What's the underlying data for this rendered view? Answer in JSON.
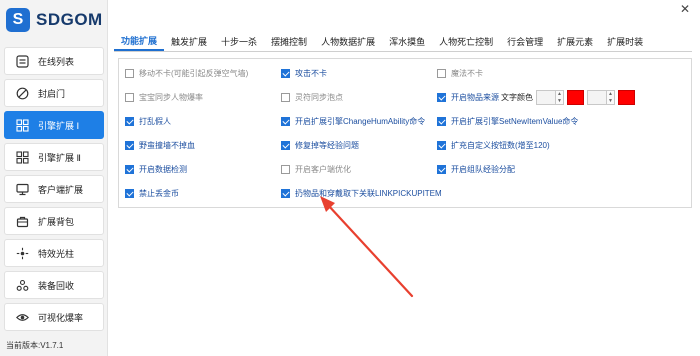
{
  "app": {
    "logo_text": "SDGOM",
    "version": "当前版本:V1.7.1"
  },
  "sidebar": {
    "items": [
      {
        "label": "在线列表",
        "icon": "list-icon",
        "active": false
      },
      {
        "label": "封启门",
        "icon": "ban-icon",
        "active": false
      },
      {
        "label": "引擎扩展 Ⅰ",
        "icon": "grid-icon",
        "active": true
      },
      {
        "label": "引擎扩展 Ⅱ",
        "icon": "grid-icon",
        "active": false
      },
      {
        "label": "客户端扩展",
        "icon": "monitor-icon",
        "active": false
      },
      {
        "label": "扩展背包",
        "icon": "bag-icon",
        "active": false
      },
      {
        "label": "特效光柱",
        "icon": "sparkle-icon",
        "active": false
      },
      {
        "label": "装备回收",
        "icon": "recycle-icon",
        "active": false
      },
      {
        "label": "可视化爆率",
        "icon": "eye-icon",
        "active": false
      }
    ]
  },
  "tabs": [
    {
      "label": "功能扩展",
      "active": true
    },
    {
      "label": "触发扩展"
    },
    {
      "label": "十步一杀"
    },
    {
      "label": "摆摊控制"
    },
    {
      "label": "人物数据扩展"
    },
    {
      "label": "浑水摸鱼"
    },
    {
      "label": "人物死亡控制"
    },
    {
      "label": "行会管理"
    },
    {
      "label": "扩展元素"
    },
    {
      "label": "扩展时装"
    }
  ],
  "options": {
    "col1": [
      {
        "label": "移动不卡(可能引起反弹空气墙)",
        "checked": false
      },
      {
        "label": "宝宝同步人物爆率",
        "checked": false
      },
      {
        "label": "打乱假人",
        "checked": true
      },
      {
        "label": "野蛮撞墙不掉血",
        "checked": true
      },
      {
        "label": "开启数据检测",
        "checked": true
      },
      {
        "label": "禁止丢金币",
        "checked": true
      }
    ],
    "col2": [
      {
        "label": "攻击不卡",
        "checked": true
      },
      {
        "label": "灵符同步泡点",
        "checked": false
      },
      {
        "label": "开启扩展引擎ChangeHumAbility命令",
        "checked": true
      },
      {
        "label": "修复掉等经验问题",
        "checked": true
      },
      {
        "label": "开启客户端优化",
        "checked": false
      },
      {
        "label": "扔物品和穿戴取下关联LINKPICKUPITEM",
        "checked": true
      }
    ],
    "col3": [
      {
        "label": "魔法不卡",
        "checked": false
      },
      {
        "label": "开启物品来源",
        "checked": true
      },
      {
        "label": "开启扩展引擎SetNewItemValue命令",
        "checked": true
      },
      {
        "label": "扩充自定义按钮数(增至120)",
        "checked": true
      },
      {
        "label": "开启组队经验分配",
        "checked": true
      }
    ]
  },
  "text_color": {
    "caption": "文字颜色",
    "swatch1": "#ff0000",
    "swatch2": "#ff0000"
  },
  "colors": {
    "accent": "#1e7fe6",
    "checked": "#1f73d8",
    "arrow": "#e8402f"
  }
}
